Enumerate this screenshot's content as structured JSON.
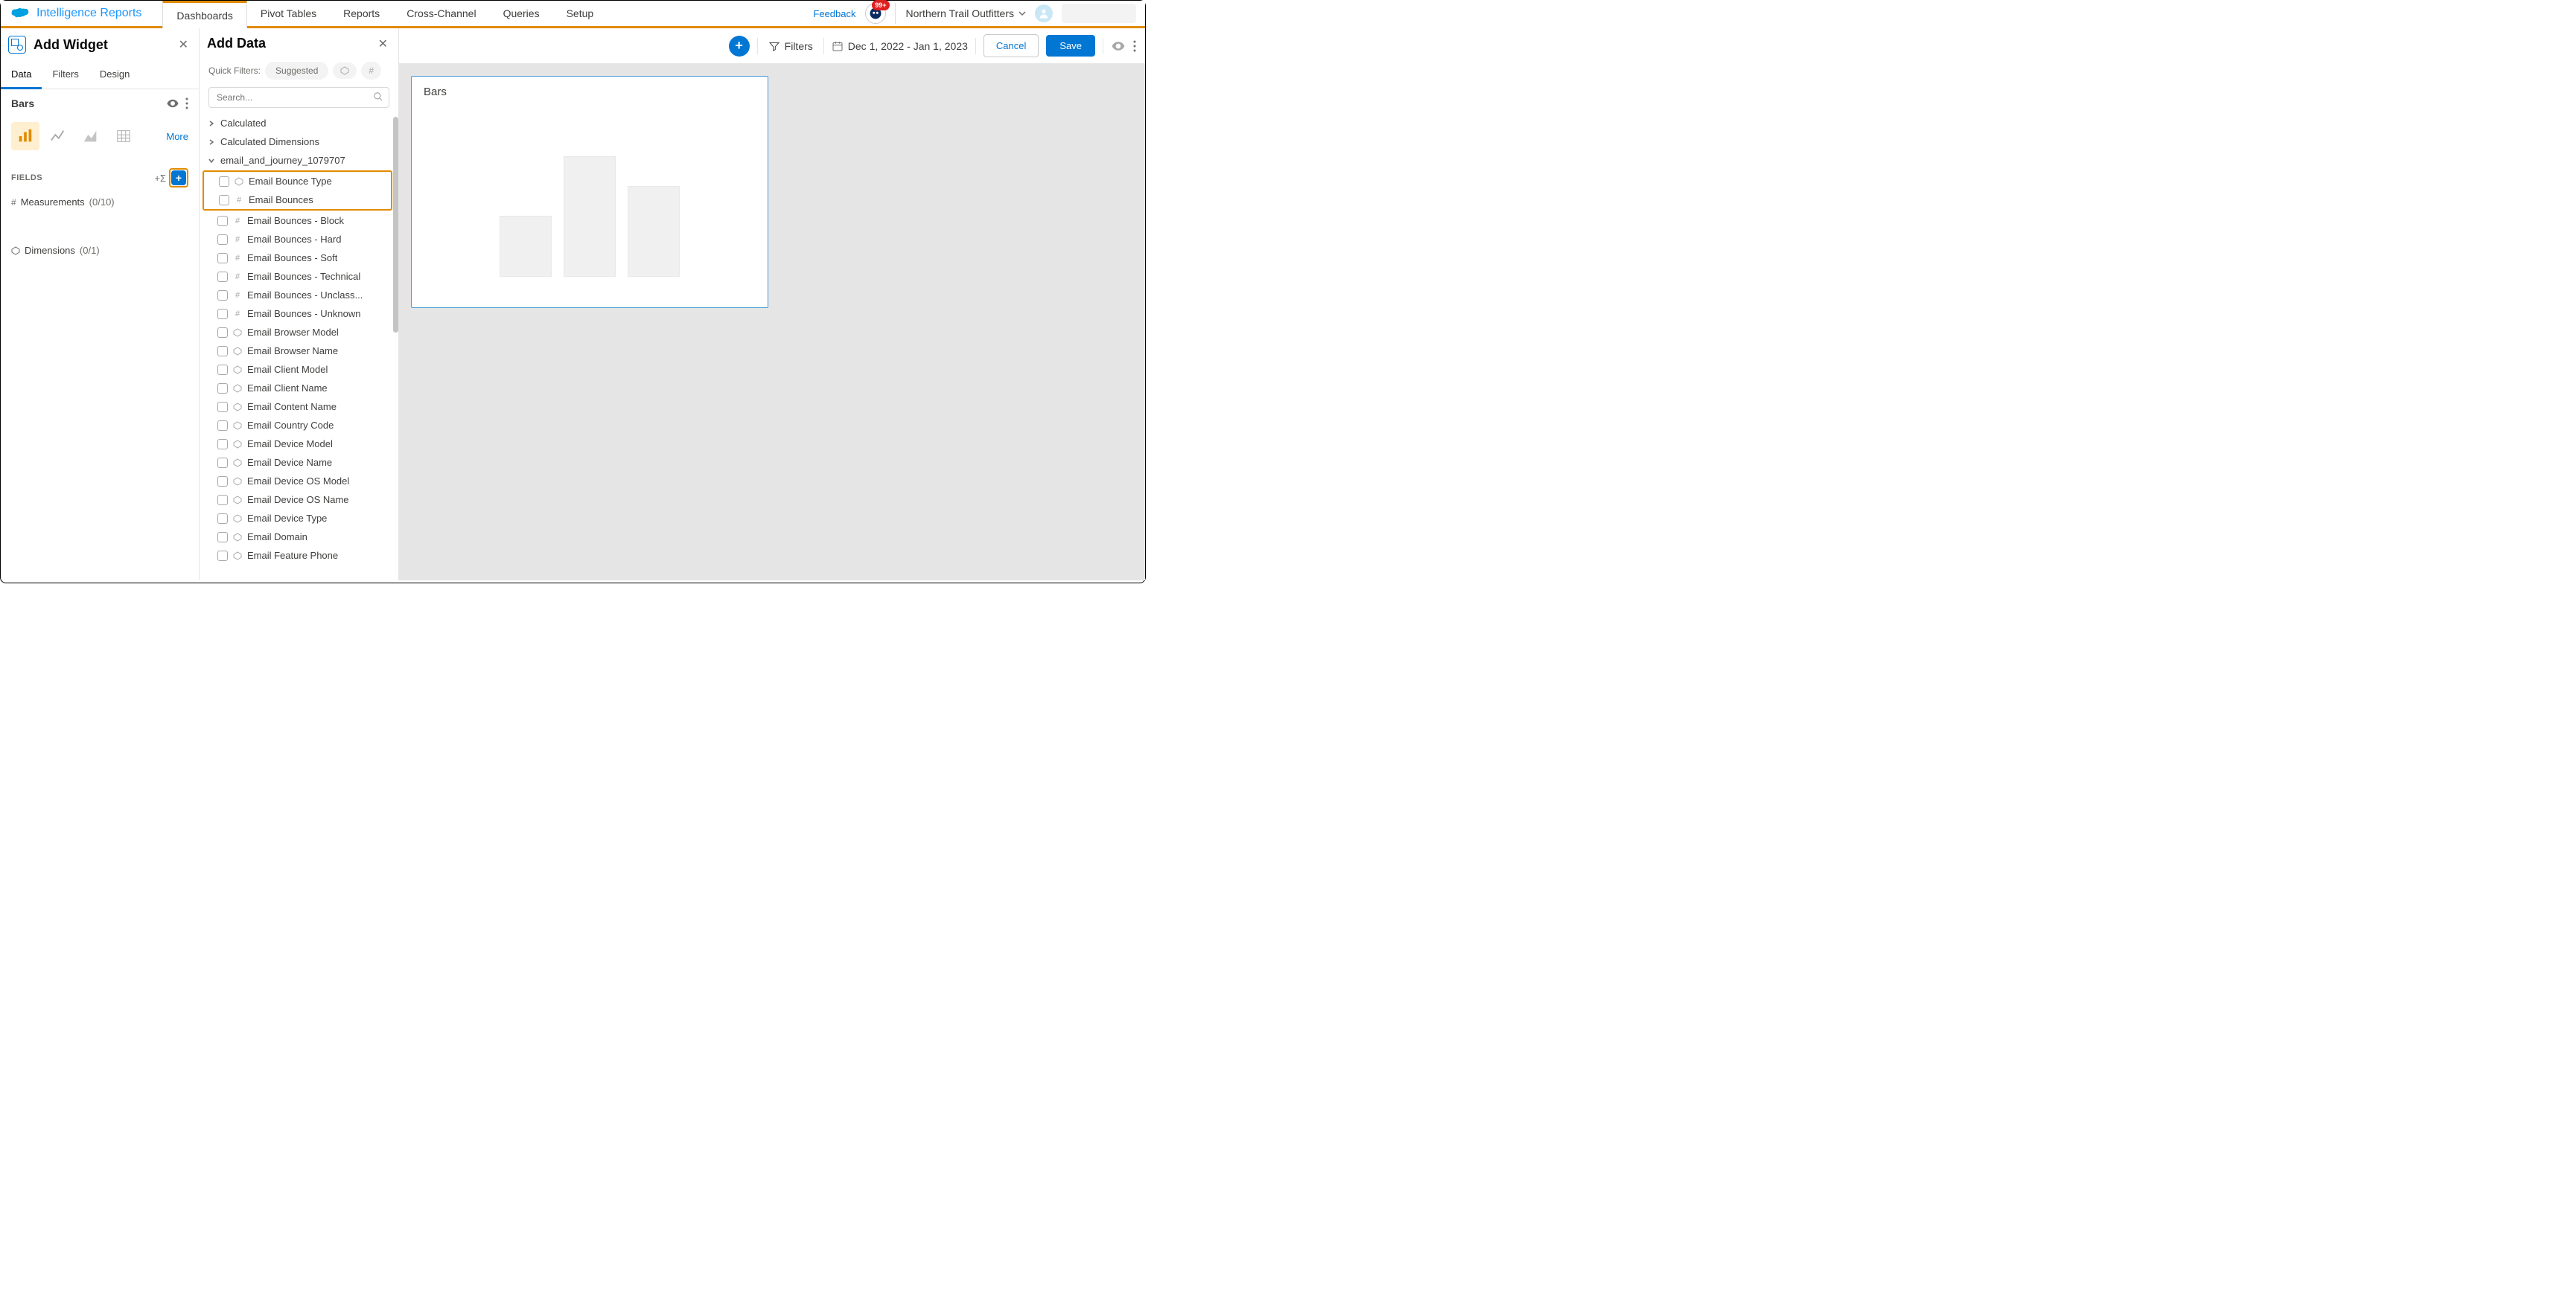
{
  "brand": "Intelligence Reports",
  "topnav": {
    "tabs": [
      "Dashboards",
      "Pivot Tables",
      "Reports",
      "Cross-Channel",
      "Queries",
      "Setup"
    ],
    "active": 0,
    "feedback": "Feedback",
    "notification_badge": "99+",
    "org_name": "Northern Trail Outfitters"
  },
  "panel1": {
    "title": "Add Widget",
    "subtabs": [
      "Data",
      "Filters",
      "Design"
    ],
    "active_subtab": 0,
    "widget_name": "Bars",
    "more_label": "More",
    "fields_label": "FIELDS",
    "measurements_label": "Measurements",
    "measurements_count": "(0/10)",
    "dimensions_label": "Dimensions",
    "dimensions_count": "(0/1)"
  },
  "panel2": {
    "title": "Add Data",
    "quick_filters_label": "Quick Filters:",
    "suggested_label": "Suggested",
    "search_placeholder": "Search...",
    "groups": [
      {
        "label": "Calculated",
        "expanded": false
      },
      {
        "label": "Calculated Dimensions",
        "expanded": false
      },
      {
        "label": "email_and_journey_1079707",
        "expanded": true
      }
    ],
    "fields": [
      {
        "label": "Email Bounce Type",
        "type": "dim",
        "highlighted": true
      },
      {
        "label": "Email Bounces",
        "type": "num",
        "highlighted": true
      },
      {
        "label": "Email Bounces - Block",
        "type": "num"
      },
      {
        "label": "Email Bounces - Hard",
        "type": "num"
      },
      {
        "label": "Email Bounces - Soft",
        "type": "num"
      },
      {
        "label": "Email Bounces - Technical",
        "type": "num"
      },
      {
        "label": "Email Bounces - Unclass...",
        "type": "num"
      },
      {
        "label": "Email Bounces - Unknown",
        "type": "num"
      },
      {
        "label": "Email Browser Model",
        "type": "dim"
      },
      {
        "label": "Email Browser Name",
        "type": "dim"
      },
      {
        "label": "Email Client Model",
        "type": "dim"
      },
      {
        "label": "Email Client Name",
        "type": "dim"
      },
      {
        "label": "Email Content Name",
        "type": "dim"
      },
      {
        "label": "Email Country Code",
        "type": "dim"
      },
      {
        "label": "Email Device Model",
        "type": "dim"
      },
      {
        "label": "Email Device Name",
        "type": "dim"
      },
      {
        "label": "Email Device OS Model",
        "type": "dim"
      },
      {
        "label": "Email Device OS Name",
        "type": "dim"
      },
      {
        "label": "Email Device Type",
        "type": "dim"
      },
      {
        "label": "Email Domain",
        "type": "dim"
      },
      {
        "label": "Email Feature Phone",
        "type": "dim"
      }
    ]
  },
  "canvas": {
    "filters_label": "Filters",
    "date_range": "Dec 1, 2022 - Jan 1, 2023",
    "cancel_label": "Cancel",
    "save_label": "Save",
    "preview_title": "Bars"
  }
}
